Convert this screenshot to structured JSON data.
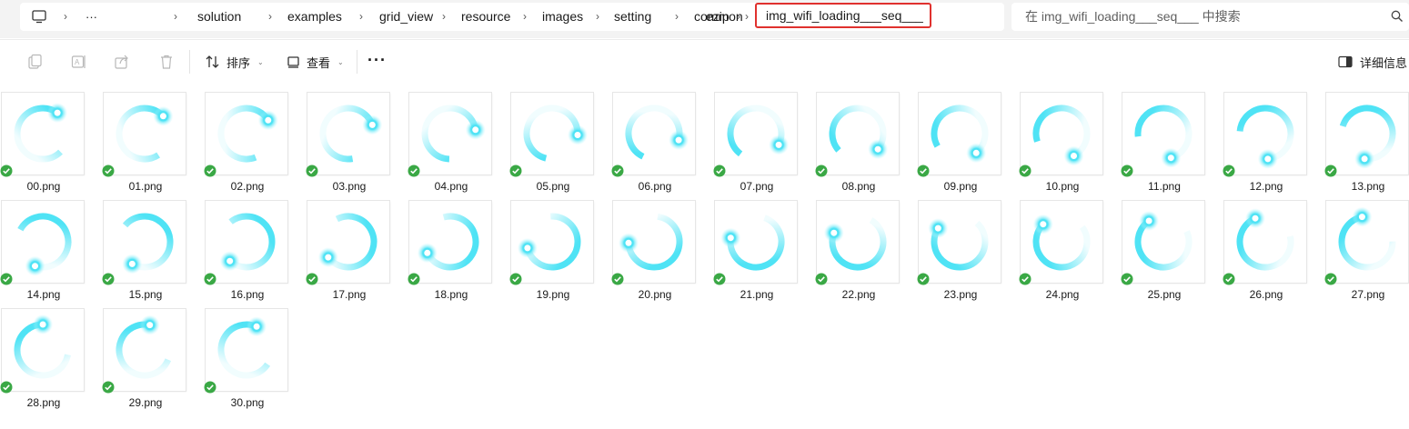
{
  "address_bar": {
    "overflow_label": "···",
    "crumbs": [
      "solution",
      "examples",
      "grid_view",
      "resource",
      "images",
      "setting",
      "common",
      "ezip"
    ],
    "current_folder": "img_wifi_loading___seq___"
  },
  "search": {
    "placeholder": "在 img_wifi_loading___seq___ 中搜索"
  },
  "toolbar": {
    "sort_label": "排序",
    "view_label": "查看",
    "more_label": "···",
    "details_label": "详细信息"
  },
  "files": [
    {
      "name": "00.png",
      "progress": 0.0
    },
    {
      "name": "01.png",
      "progress": 0.0323
    },
    {
      "name": "02.png",
      "progress": 0.0645
    },
    {
      "name": "03.png",
      "progress": 0.0968
    },
    {
      "name": "04.png",
      "progress": 0.129
    },
    {
      "name": "05.png",
      "progress": 0.1613
    },
    {
      "name": "06.png",
      "progress": 0.1935
    },
    {
      "name": "07.png",
      "progress": 0.2258
    },
    {
      "name": "08.png",
      "progress": 0.2581
    },
    {
      "name": "09.png",
      "progress": 0.2903
    },
    {
      "name": "10.png",
      "progress": 0.3226
    },
    {
      "name": "11.png",
      "progress": 0.3548
    },
    {
      "name": "12.png",
      "progress": 0.3871
    },
    {
      "name": "13.png",
      "progress": 0.4194
    },
    {
      "name": "14.png",
      "progress": 0.4516
    },
    {
      "name": "15.png",
      "progress": 0.4839
    },
    {
      "name": "16.png",
      "progress": 0.5161
    },
    {
      "name": "17.png",
      "progress": 0.5484
    },
    {
      "name": "18.png",
      "progress": 0.5806
    },
    {
      "name": "19.png",
      "progress": 0.6129
    },
    {
      "name": "20.png",
      "progress": 0.6452
    },
    {
      "name": "21.png",
      "progress": 0.6774
    },
    {
      "name": "22.png",
      "progress": 0.7097
    },
    {
      "name": "23.png",
      "progress": 0.7419
    },
    {
      "name": "24.png",
      "progress": 0.7742
    },
    {
      "name": "25.png",
      "progress": 0.8065
    },
    {
      "name": "26.png",
      "progress": 0.8387
    },
    {
      "name": "27.png",
      "progress": 0.871
    },
    {
      "name": "28.png",
      "progress": 0.9032
    },
    {
      "name": "29.png",
      "progress": 0.9355
    },
    {
      "name": "30.png",
      "progress": 0.9677
    }
  ],
  "colors": {
    "spinner_arc": "#4fe3f5",
    "spinner_glow": "#b8f6fc",
    "sync_badge": "#3aa845",
    "highlight_border": "#e0312e"
  },
  "icons": {
    "location": "computer-icon",
    "copy": "copy-icon",
    "rename": "rename-icon",
    "share": "share-icon",
    "delete": "trash-icon",
    "sort": "sort-icon",
    "view": "view-icon",
    "details": "details-pane-icon",
    "search": "search-icon",
    "status": "checkmark-icon"
  }
}
